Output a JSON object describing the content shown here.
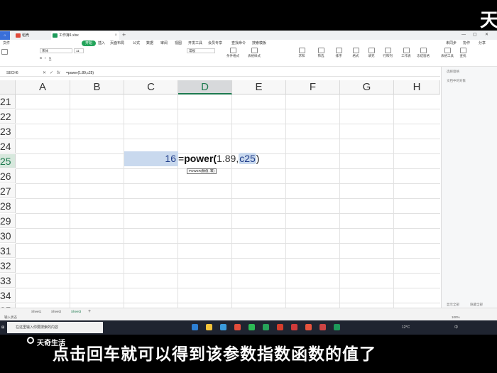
{
  "brand": {
    "corner_glyph": "天",
    "watermark": "天奇生活"
  },
  "subtitle": "点击回车就可以得到该参数指数函数的值了",
  "tabs": [
    {
      "label": "首页"
    },
    {
      "label": "稻壳"
    },
    {
      "label": "工作簿1.xlsx"
    }
  ],
  "menu": [
    "文件",
    "开始",
    "插入",
    "页面布局",
    "公式",
    "数据",
    "审阅",
    "视图",
    "开发工具",
    "会员专享",
    "查找命令",
    "搜索模板"
  ],
  "top_right": [
    "未同步",
    "协作",
    "分享"
  ],
  "ribbon": {
    "font_name": "宋体",
    "font_size": "11",
    "format": "常规",
    "groups": [
      "条件格式",
      "表格样式",
      "求和",
      "筛选",
      "排序",
      "格式",
      "填充",
      "行和列",
      "工作表",
      "冻结窗格",
      "表格工具",
      "查找"
    ]
  },
  "formula_bar": {
    "name_box": "SECH6",
    "formula": "=power(1.89,c25)"
  },
  "columns": [
    "A",
    "B",
    "C",
    "D",
    "E",
    "F",
    "G",
    "H"
  ],
  "rows": [
    "21",
    "22",
    "23",
    "24",
    "25",
    "26",
    "27",
    "28",
    "29",
    "30",
    "31",
    "32",
    "33",
    "34",
    "35"
  ],
  "cells": {
    "c25": "16",
    "d25_eq": "=",
    "d25_fn": "power(",
    "d25_num": "1.89,",
    "d25_ref": "c25",
    "d25_close": ")"
  },
  "tooltip": "POWER(数值, 幂)",
  "right_pane": {
    "title": "选择窗格",
    "sub": "文档中的对象",
    "bottom": [
      "显示全部",
      "隐藏全部"
    ]
  },
  "sheets": [
    "Sheet1",
    "Sheet2",
    "Sheet3"
  ],
  "status": {
    "left": "输入状态",
    "zoom": "100%"
  },
  "taskbar": {
    "search_placeholder": "在这里输入你要搜索的内容",
    "temp": "12°C",
    "lang": "中"
  }
}
